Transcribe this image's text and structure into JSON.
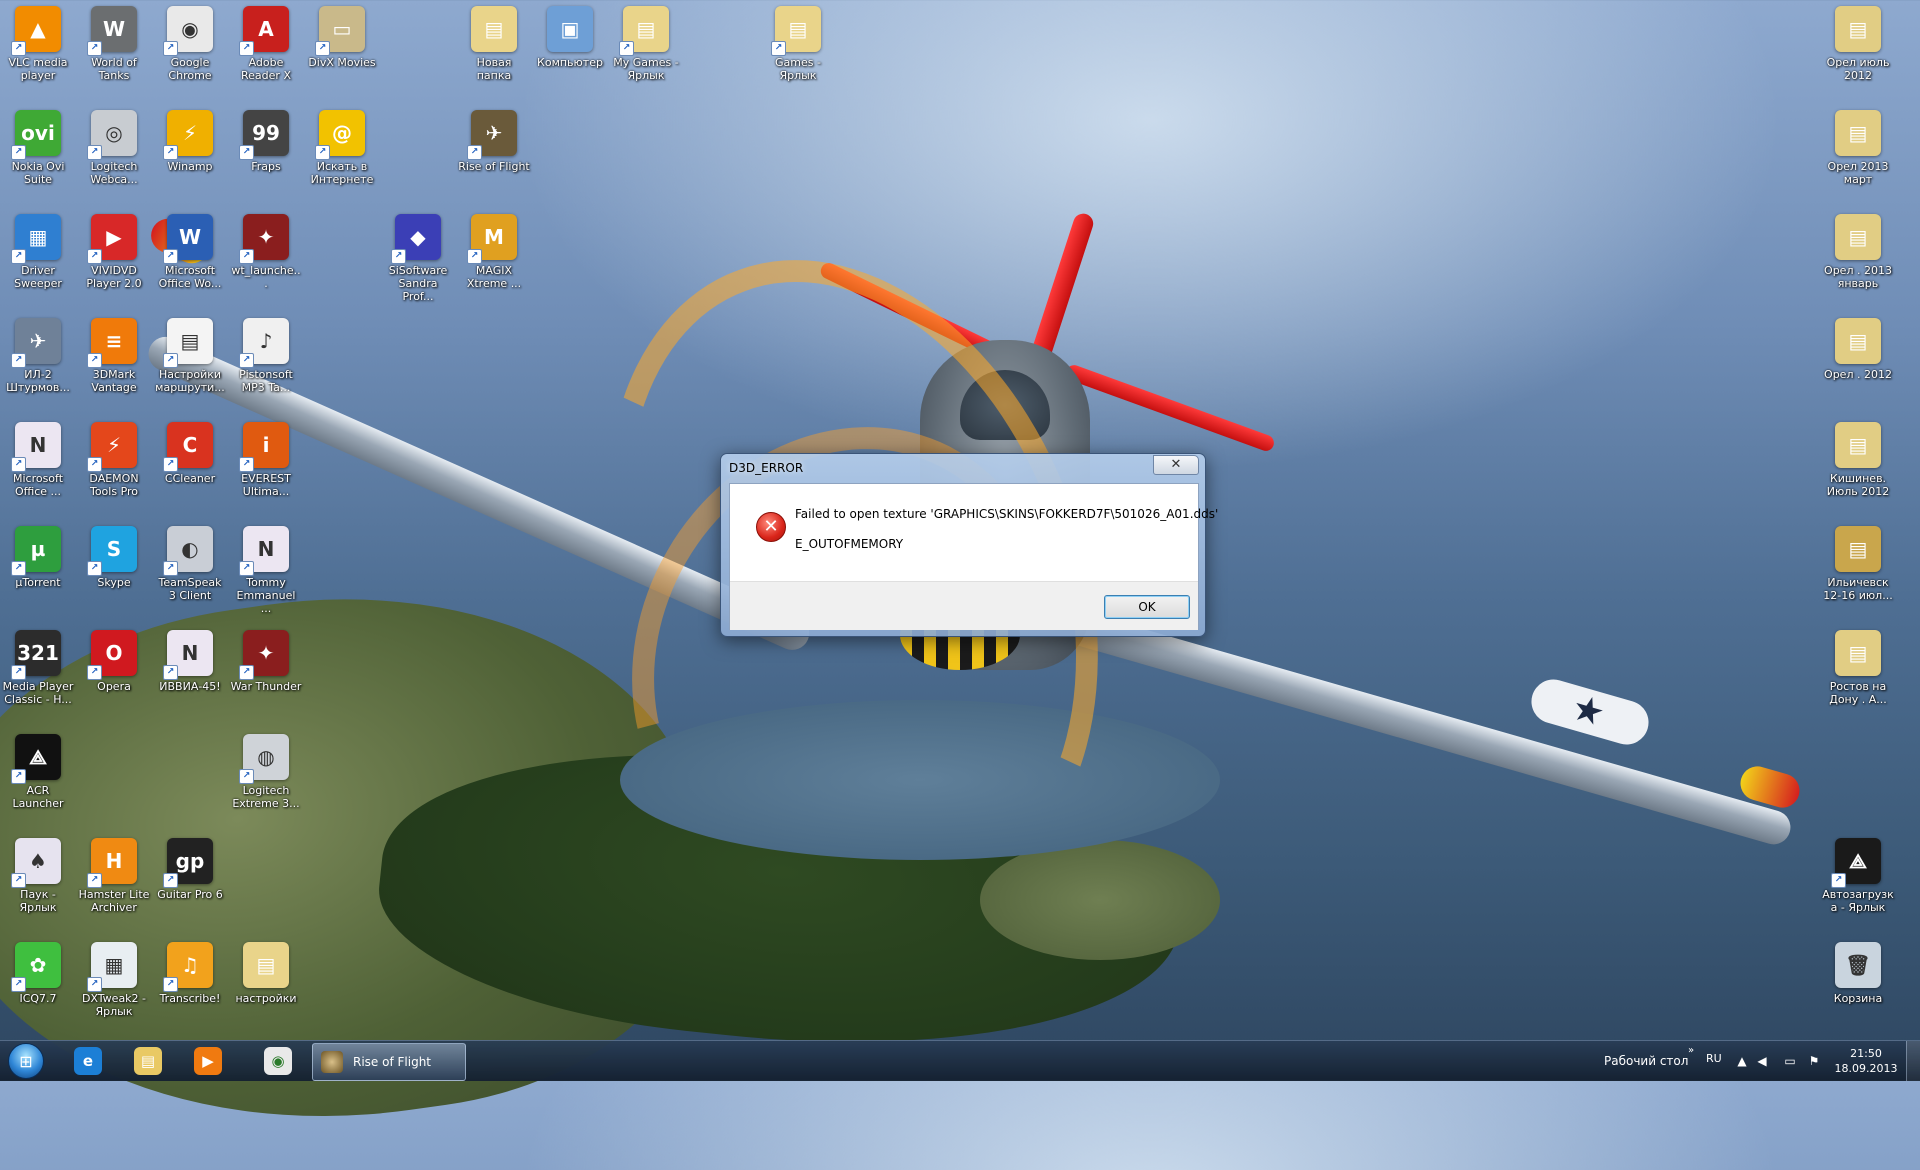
{
  "desktop": {
    "icons": [
      {
        "label": "VLC media player",
        "icon": "vlc-icon",
        "bg": "#f28c00",
        "glyph": "▲"
      },
      {
        "label": "World of Tanks",
        "icon": "tank-icon",
        "bg": "#6b6e70",
        "glyph": "W"
      },
      {
        "label": "Google Chrome",
        "icon": "chrome-icon",
        "bg": "#e9e9e9",
        "glyph": "◉"
      },
      {
        "label": "Adobe Reader X",
        "icon": "pdf-icon",
        "bg": "#c8201d",
        "glyph": "A"
      },
      {
        "label": "DivX Movies",
        "icon": "divx-icon",
        "bg": "#c9b98a",
        "glyph": "▭"
      },
      {
        "label": "Новая папка",
        "icon": "folder-icon",
        "bg": "#e9d48a",
        "glyph": "▤"
      },
      {
        "label": "Компьютер",
        "icon": "computer-icon",
        "bg": "#6e9fd6",
        "glyph": "▣"
      },
      {
        "label": "My Games - Ярлык",
        "icon": "folder-icon",
        "bg": "#e9d48a",
        "glyph": "▤"
      },
      {
        "label": "Games - Ярлык",
        "icon": "folder-icon",
        "bg": "#e9d48a",
        "glyph": "▤"
      },
      {
        "label": "Орел июль 2012",
        "icon": "folder-icon",
        "bg": "#e1cd84",
        "glyph": "▤"
      },
      {
        "label": "Nokia Ovi Suite",
        "icon": "ovi-icon",
        "bg": "#3fa935",
        "glyph": "ovi"
      },
      {
        "label": "Logitech Webca...",
        "icon": "webcam-icon",
        "bg": "#c8ccd1",
        "glyph": "◎"
      },
      {
        "label": "Winamp",
        "icon": "winamp-icon",
        "bg": "#f0b000",
        "glyph": "⚡"
      },
      {
        "label": "Fraps",
        "icon": "fraps-icon",
        "bg": "#444",
        "glyph": "99"
      },
      {
        "label": "Искать в Интернете",
        "icon": "search-web-icon",
        "bg": "#f2c200",
        "glyph": "@"
      },
      {
        "label": "Rise of Flight",
        "icon": "rise-of-flight-icon",
        "bg": "#6a5a3a",
        "glyph": "✈"
      },
      {
        "label": "Орел 2013 март",
        "icon": "folder-icon",
        "bg": "#e1cd84",
        "glyph": "▤"
      },
      {
        "label": "Driver Sweeper",
        "icon": "driver-sweeper-icon",
        "bg": "#2f7fd1",
        "glyph": "▦"
      },
      {
        "label": "VIVIDVD Player 2.0",
        "icon": "dvd-player-icon",
        "bg": "#d82828",
        "glyph": "▶"
      },
      {
        "label": "Microsoft Office Wo...",
        "icon": "word-icon",
        "bg": "#2b5fb4",
        "glyph": "W"
      },
      {
        "label": "wt_launche...",
        "icon": "war-thunder-launcher-icon",
        "bg": "#8a1e1e",
        "glyph": "✦"
      },
      {
        "label": "SiSoftware Sandra Prof...",
        "icon": "sandra-icon",
        "bg": "#3b3fb6",
        "glyph": "◆"
      },
      {
        "label": "MAGIX Xtreme ...",
        "icon": "magix-icon",
        "bg": "#e0a020",
        "glyph": "M"
      },
      {
        "label": "Орел . 2013 январь",
        "icon": "folder-icon",
        "bg": "#e1cd84",
        "glyph": "▤"
      },
      {
        "label": "ИЛ-2 Штурмов...",
        "icon": "il2-icon",
        "bg": "#6f8198",
        "glyph": "✈"
      },
      {
        "label": "3DMark Vantage",
        "icon": "3dmark-icon",
        "bg": "#f07a0a",
        "glyph": "≡"
      },
      {
        "label": "Настройки маршрути...",
        "icon": "document-icon",
        "bg": "#f4f4f4",
        "glyph": "▤"
      },
      {
        "label": "Pistonsoft MP3 Ta...",
        "icon": "mp3-tag-icon",
        "bg": "#f0f0f0",
        "glyph": "♪"
      },
      {
        "label": "Орел . 2012",
        "icon": "folder-icon",
        "bg": "#e1cd84",
        "glyph": "▤"
      },
      {
        "label": "Microsoft Office ...",
        "icon": "onenote-icon",
        "bg": "#ece6f2",
        "glyph": "N"
      },
      {
        "label": "DAEMON Tools Pro",
        "icon": "daemon-tools-icon",
        "bg": "#e4471b",
        "glyph": "⚡"
      },
      {
        "label": "CCleaner",
        "icon": "ccleaner-icon",
        "bg": "#d9331f",
        "glyph": "C"
      },
      {
        "label": "EVEREST Ultima...",
        "icon": "everest-icon",
        "bg": "#e05a10",
        "glyph": "i"
      },
      {
        "label": "Кишинев. Июль 2012",
        "icon": "folder-icon",
        "bg": "#e1cd84",
        "glyph": "▤"
      },
      {
        "label": "µTorrent",
        "icon": "utorrent-icon",
        "bg": "#2e9e3e",
        "glyph": "µ"
      },
      {
        "label": "Skype",
        "icon": "skype-icon",
        "bg": "#1fa3e0",
        "glyph": "S"
      },
      {
        "label": "TeamSpeak 3 Client",
        "icon": "teamspeak-icon",
        "bg": "#c9ced6",
        "glyph": "◐"
      },
      {
        "label": "Tommy Emmanuel ...",
        "icon": "onenote-icon",
        "bg": "#ece6f2",
        "glyph": "N"
      },
      {
        "label": "Ильичевск 12-16 июл...",
        "icon": "folder-icon",
        "bg": "#c9a64c",
        "glyph": "▤"
      },
      {
        "label": "Media Player Classic - H...",
        "icon": "media-player-classic-icon",
        "bg": "#2c2c2c",
        "glyph": "321"
      },
      {
        "label": "Opera",
        "icon": "opera-icon",
        "bg": "#d0191f",
        "glyph": "O"
      },
      {
        "label": "ИВВИА-45!",
        "icon": "onenote-icon",
        "bg": "#ece6f2",
        "glyph": "N"
      },
      {
        "label": "War Thunder",
        "icon": "war-thunder-icon",
        "bg": "#8a1e1e",
        "glyph": "✦"
      },
      {
        "label": "Ростов на Дону . А...",
        "icon": "folder-icon",
        "bg": "#e1cd84",
        "glyph": "▤"
      },
      {
        "label": "ACR Launcher",
        "icon": "acr-launcher-icon",
        "bg": "#111",
        "glyph": "⟁"
      },
      {
        "label": "Logitech Extreme 3...",
        "icon": "joystick-icon",
        "bg": "#cfd3d8",
        "glyph": "◍"
      },
      {
        "label": "Паук - Ярлык",
        "icon": "spider-icon",
        "bg": "#e6e3ef",
        "glyph": "♠"
      },
      {
        "label": "Hamster Lite Archiver",
        "icon": "hamster-icon",
        "bg": "#f08a12",
        "glyph": "H"
      },
      {
        "label": "Guitar Pro 6",
        "icon": "guitar-pro-icon",
        "bg": "#222",
        "glyph": "gp"
      },
      {
        "label": "Автозагрузка - Ярлык",
        "icon": "autostart-icon",
        "bg": "#1a1a1a",
        "glyph": "⟁"
      },
      {
        "label": "ICQ7.7",
        "icon": "icq-icon",
        "bg": "#3fbf3f",
        "glyph": "✿"
      },
      {
        "label": "DXTweak2 - Ярлык",
        "icon": "dxtweak-icon",
        "bg": "#e8eef2",
        "glyph": "▦"
      },
      {
        "label": "Transcribe!",
        "icon": "transcribe-icon",
        "bg": "#f2a21c",
        "glyph": "♫"
      },
      {
        "label": "настройки",
        "icon": "folder-icon",
        "bg": "#e9d48a",
        "glyph": "▤"
      },
      {
        "label": "Корзина",
        "icon": "recycle-bin-icon",
        "bg": "#c9d4de",
        "glyph": "🗑"
      }
    ]
  },
  "dialog": {
    "title": "D3D_ERROR",
    "close_label": "✕",
    "message": "Failed to open texture 'GRAPHICS\\SKINS\\FOKKERD7F\\501026_A01.dds'",
    "error_code": "E_OUTOFMEMORY",
    "ok_label": "OK",
    "icon": "error-icon"
  },
  "taskbar": {
    "start_icon": "windows-start-icon",
    "pinned": [
      {
        "name": "internet-explorer-icon",
        "bg": "#1c7fd6",
        "glyph": "e"
      },
      {
        "name": "explorer-folder-icon",
        "bg": "#e9c964",
        "glyph": "▤"
      },
      {
        "name": "media-player-icon",
        "bg": "#f07a10",
        "glyph": "▶"
      },
      {
        "name": "chrome-icon",
        "bg": "#e9e9e9",
        "glyph": "◉"
      }
    ],
    "active_task_label": "Rise of Flight",
    "desktop_label": "Рабочий стол",
    "show_more": "»",
    "language": "RU",
    "tray": [
      {
        "name": "tray-up-arrow-icon",
        "glyph": "▲"
      },
      {
        "name": "volume-icon",
        "glyph": "◀"
      },
      {
        "name": "network-icon",
        "glyph": "▭"
      },
      {
        "name": "action-center-flag-icon",
        "glyph": "⚑"
      }
    ],
    "time": "21:50",
    "date": "18.09.2013"
  }
}
